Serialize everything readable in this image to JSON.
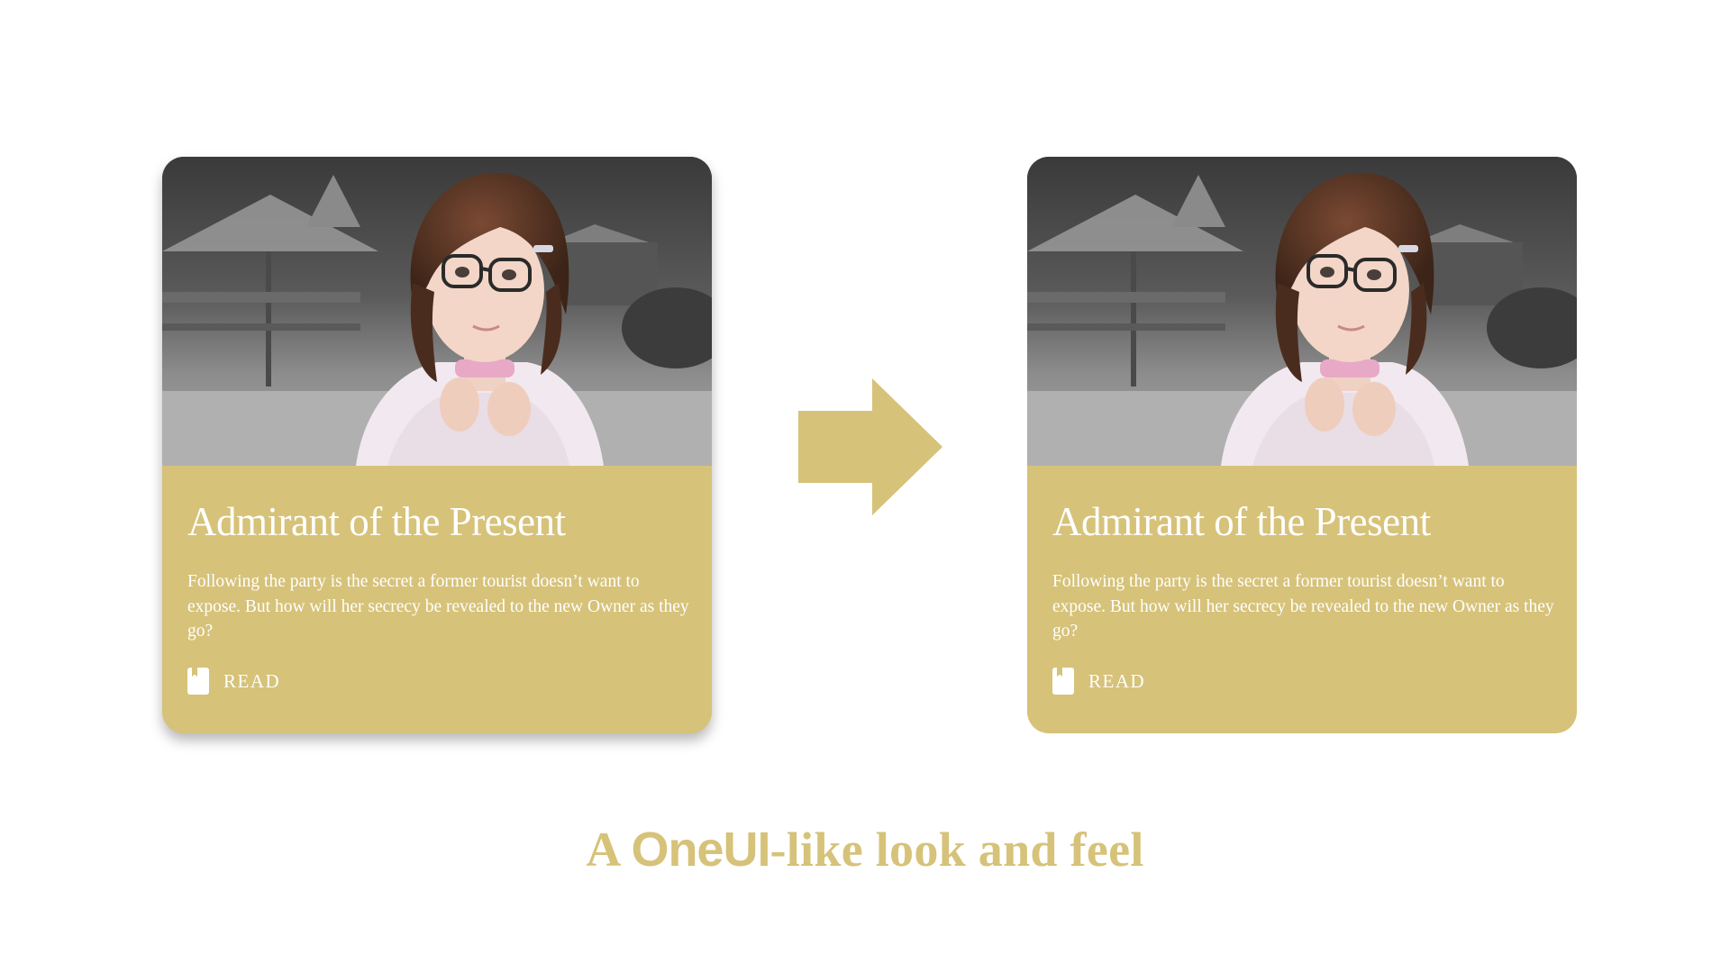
{
  "colors": {
    "accent": "#d6c279",
    "card_text": "#ffffff",
    "background": "#ffffff"
  },
  "cards": [
    {
      "variant": "before",
      "title": "Admirant of the Present",
      "description": "Following the party is the secret a former tourist doesn’t want to expose. But how will her secrecy be revealed to the new Owner as they go?",
      "action_icon": "book-icon",
      "action_label": "READ"
    },
    {
      "variant": "after",
      "title": "Admirant of the Present",
      "description": "Following the party is the secret a former tourist doesn’t want to expose. But how will her secrecy be revealed to the new Owner as they go?",
      "action_icon": "book-icon",
      "action_label": "READ"
    }
  ],
  "transition_icon": "arrow-right-icon",
  "caption": {
    "prefix": "A ",
    "brand": "OneUI",
    "suffix": "-like look and feel"
  }
}
